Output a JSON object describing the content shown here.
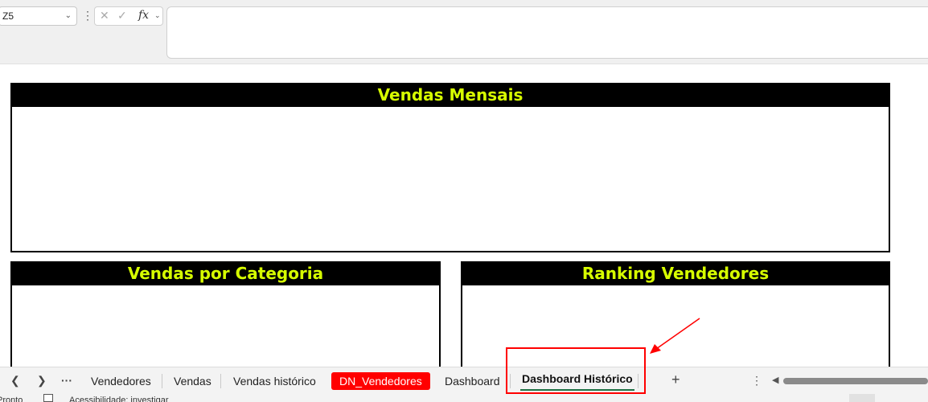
{
  "formula": {
    "name_box": "Z5",
    "fx_label": "fx"
  },
  "panels": [
    {
      "title": "Vendas Mensais"
    },
    {
      "title": "Vendas por Categoria"
    },
    {
      "title": "Ranking Vendedores"
    }
  ],
  "tabs": [
    {
      "label": "Vendedores"
    },
    {
      "label": "Vendas"
    },
    {
      "label": "Vendas histórico"
    },
    {
      "label": "DN_Vendedores"
    },
    {
      "label": "Dashboard"
    },
    {
      "label": "Dashboard Histórico"
    }
  ],
  "status": {
    "ready": "Pronto",
    "accessibility": "Acessibilidade: investigar"
  },
  "colors": {
    "panel_header_bg": "#000000",
    "panel_header_text": "#d7ff00",
    "highlight": "#ff0000",
    "active_underline": "#1e7145"
  }
}
